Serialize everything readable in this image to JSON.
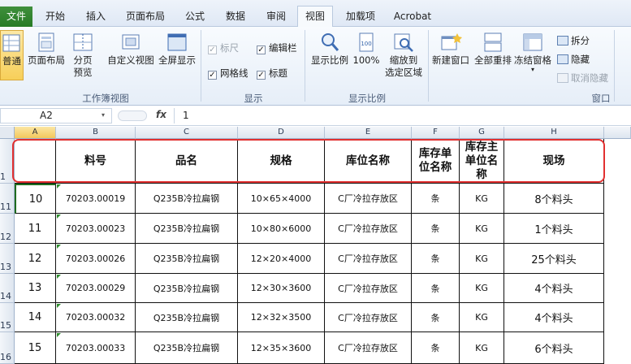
{
  "tabs": [
    {
      "name": "file",
      "label": "文件"
    },
    {
      "name": "home",
      "label": "开始"
    },
    {
      "name": "insert",
      "label": "插入"
    },
    {
      "name": "page-layout",
      "label": "页面布局"
    },
    {
      "name": "formulas",
      "label": "公式"
    },
    {
      "name": "data",
      "label": "数据"
    },
    {
      "name": "review",
      "label": "审阅"
    },
    {
      "name": "view",
      "label": "视图"
    },
    {
      "name": "addins",
      "label": "加载项"
    },
    {
      "name": "acrobat",
      "label": "Acrobat"
    }
  ],
  "ribbon": {
    "normal": "普通",
    "page_layout": "页面布局",
    "page_break_l1": "分页",
    "page_break_l2": "预览",
    "custom_view": "自定义视图",
    "full_screen": "全屏显示",
    "group_workbook_views": "工作簿视图",
    "ruler": "标尺",
    "formula_bar": "编辑栏",
    "gridlines": "网格线",
    "headings": "标题",
    "group_show": "显示",
    "zoom": "显示比例",
    "zoom100": "100%",
    "zoom_sel_l1": "缩放到",
    "zoom_sel_l2": "选定区域",
    "group_zoom": "显示比例",
    "new_window": "新建窗口",
    "arrange_all": "全部重排",
    "freeze_panes": "冻结窗格",
    "split": "拆分",
    "hide": "隐藏",
    "unhide": "取消隐藏",
    "group_window": "窗口"
  },
  "formula": {
    "cell_ref": "A2",
    "fx": "fx",
    "value": "1"
  },
  "columns": [
    "A",
    "B",
    "C",
    "D",
    "E",
    "F",
    "G",
    "H"
  ],
  "headers": {
    "a": "",
    "b": "料号",
    "c": "品名",
    "d": "规格",
    "e": "库位名称",
    "f_l1": "库存单",
    "f_l2": "位名称",
    "g_l1": "库存主",
    "g_l2": "单位名",
    "g_l3": "称",
    "h": "现场"
  },
  "row_numbers": [
    "1",
    "11",
    "12",
    "13",
    "14",
    "15",
    "16"
  ],
  "rows": [
    {
      "a": "10",
      "b": "70203.00019",
      "c": "Q235B冷拉扁钢",
      "d": "10×65×4000",
      "e": "C厂冷拉存放区",
      "f": "条",
      "g": "KG",
      "h": "8个料头"
    },
    {
      "a": "11",
      "b": "70203.00023",
      "c": "Q235B冷拉扁钢",
      "d": "10×80×6000",
      "e": "C厂冷拉存放区",
      "f": "条",
      "g": "KG",
      "h": "1个料头"
    },
    {
      "a": "12",
      "b": "70203.00026",
      "c": "Q235B冷拉扁钢",
      "d": "12×20×4000",
      "e": "C厂冷拉存放区",
      "f": "条",
      "g": "KG",
      "h": "25个料头"
    },
    {
      "a": "13",
      "b": "70203.00029",
      "c": "Q235B冷拉扁钢",
      "d": "12×30×3600",
      "e": "C厂冷拉存放区",
      "f": "条",
      "g": "KG",
      "h": "4个料头"
    },
    {
      "a": "14",
      "b": "70203.00032",
      "c": "Q235B冷拉扁钢",
      "d": "12×32×3500",
      "e": "C厂冷拉存放区",
      "f": "条",
      "g": "KG",
      "h": "4个料头"
    },
    {
      "a": "15",
      "b": "70203.00033",
      "c": "Q235B冷拉扁钢",
      "d": "12×35×3600",
      "e": "C厂冷拉存放区",
      "f": "条",
      "g": "KG",
      "h": "6个料头"
    }
  ]
}
